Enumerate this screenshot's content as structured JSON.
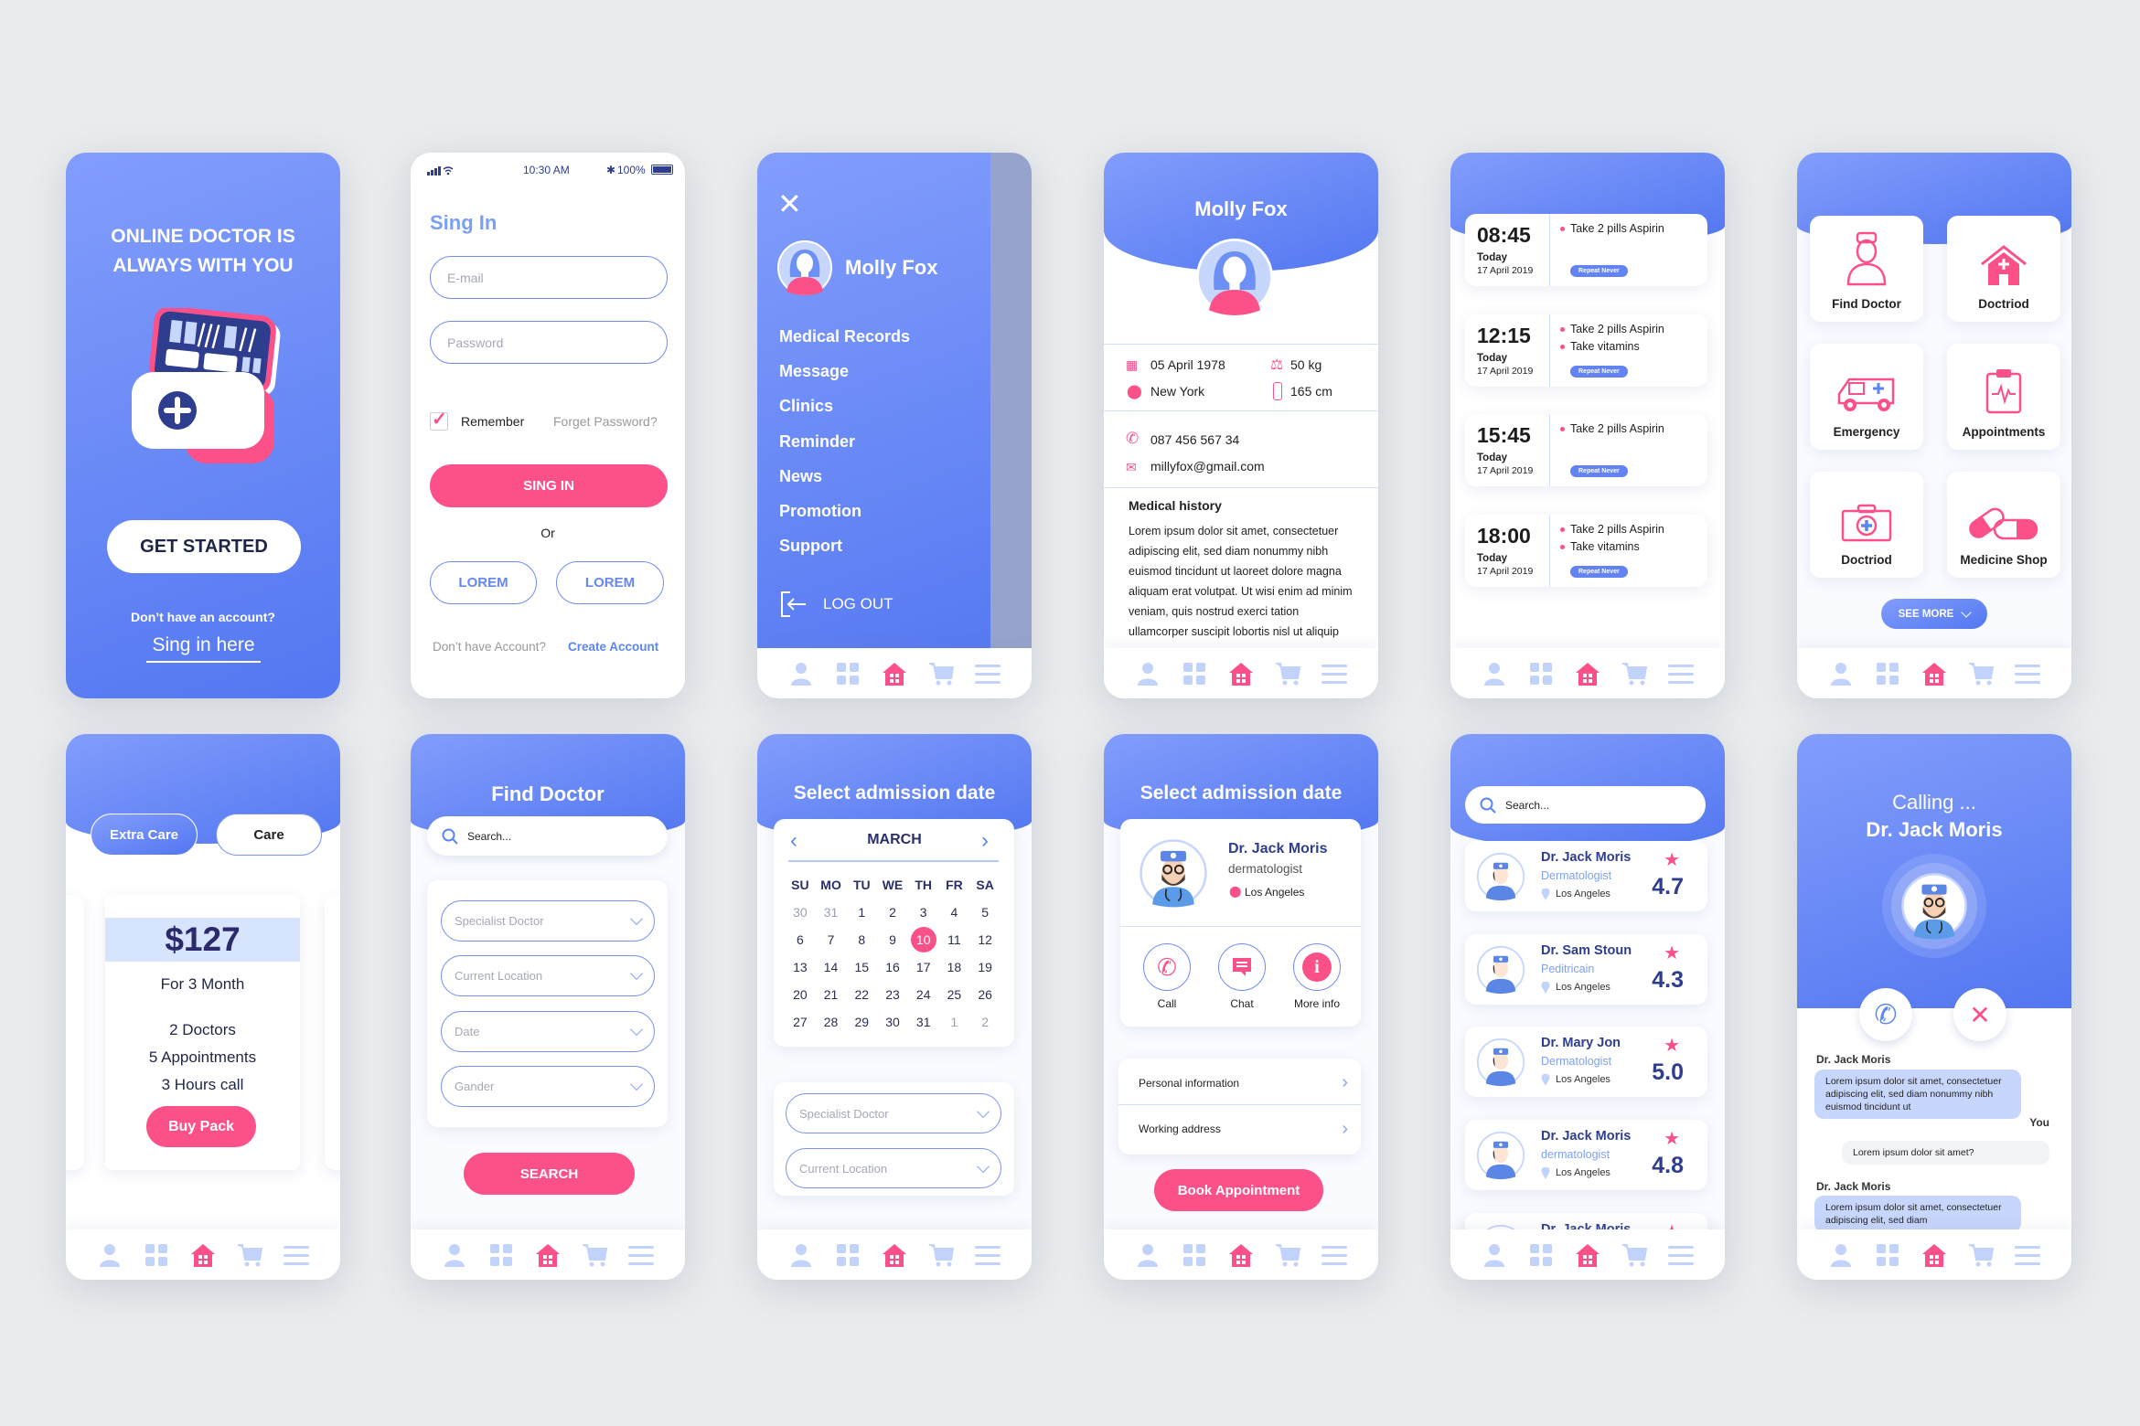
{
  "colors": {
    "primary": "#5b7df2",
    "accent": "#fb5188",
    "navy": "#2e3d8e",
    "light": "#c7d6fc"
  },
  "bottom_nav": [
    "person-icon",
    "grid-icon",
    "home-icon",
    "cart-icon",
    "menu-icon"
  ],
  "onboarding": {
    "title_line1": "ONLINE DOCTOR IS",
    "title_line2": "ALWAYS WITH YOU",
    "cta": "GET STARTED",
    "prompt": "Don’t have an account?",
    "link": "Sing in here"
  },
  "signin": {
    "status": {
      "time": "10:30 AM",
      "battery": "100%"
    },
    "title": "Sing In",
    "email_placeholder": "E-mail",
    "password_placeholder": "Password",
    "remember": "Remember",
    "remember_checked": true,
    "forgot": "Forget Password?",
    "submit": "SING IN",
    "or": "Or",
    "alt1": "LOREM",
    "alt2": "LOREM",
    "no_account": "Don’t have Account?",
    "create": "Create Account"
  },
  "menu": {
    "user": "Molly Fox",
    "items": [
      "Medical Records",
      "Message",
      "Clinics",
      "Reminder",
      "News",
      "Promotion",
      "Support"
    ],
    "logout": "LOG OUT"
  },
  "profile": {
    "name": "Molly Fox",
    "dob": "05 April 1978",
    "city": "New York",
    "weight": "50 kg",
    "height": "165 cm",
    "phone": "087 456 567 34",
    "email": "millyfox@gmail.com",
    "history_title": "Medical history",
    "history": "Lorem ipsum dolor sit amet, consectetuer adipiscing elit, sed diam nonummy nibh euismod tincidunt ut laoreet dolore magna aliquam erat volutpat. Ut wisi enim ad minim veniam, quis nostrud exerci tation ullamcorper suscipit lobortis nisl ut aliquip"
  },
  "reminders": [
    {
      "time": "08:45",
      "day": "Today",
      "date": "17 April 2019",
      "meds": [
        "Take 2 pills Aspirin"
      ],
      "badge": "Repeat Never"
    },
    {
      "time": "12:15",
      "day": "Today",
      "date": "17 April 2019",
      "meds": [
        "Take 2 pills Aspirin",
        "Take vitamins"
      ],
      "badge": "Repeat Never"
    },
    {
      "time": "15:45",
      "day": "Today",
      "date": "17 April 2019",
      "meds": [
        "Take 2 pills Aspirin"
      ],
      "badge": "Repeat Never"
    },
    {
      "time": "18:00",
      "day": "Today",
      "date": "17 April 2019",
      "meds": [
        "Take 2 pills Aspirin",
        "Take vitamins"
      ],
      "badge": "Repeat Never"
    }
  ],
  "home_grid": {
    "tiles": [
      "Find Doctor",
      "Doctriod",
      "Emergency",
      "Appointments",
      "Doctriod",
      "Medicine Shop"
    ],
    "see_more": "SEE MORE"
  },
  "plans": {
    "tabs": [
      "Extra Care",
      "Care"
    ],
    "active_tab": "Extra Care",
    "price": "$127",
    "period": "For 3 Month",
    "features": [
      "2 Doctors",
      "5 Appointments",
      "3 Hours call"
    ],
    "buy": "Buy Pack"
  },
  "find_doctor": {
    "title": "Find Doctor",
    "search_placeholder": "Search...",
    "selects": [
      "Specialist Doctor",
      "Current Location",
      "Date",
      "Gander"
    ],
    "submit": "SEARCH"
  },
  "calendar": {
    "title": "Select admission date",
    "month": "MARCH",
    "weekdays": [
      "SU",
      "MO",
      "TU",
      "WE",
      "TH",
      "FR",
      "SA"
    ],
    "weeks": [
      [
        "30",
        "31",
        "1",
        "2",
        "3",
        "4",
        "5"
      ],
      [
        "6",
        "7",
        "8",
        "9",
        "10",
        "11",
        "12"
      ],
      [
        "13",
        "14",
        "15",
        "16",
        "17",
        "18",
        "19"
      ],
      [
        "20",
        "21",
        "22",
        "23",
        "24",
        "25",
        "26"
      ],
      [
        "27",
        "28",
        "29",
        "30",
        "31",
        "1",
        "2"
      ]
    ],
    "selected": "10",
    "selects": [
      "Specialist Doctor",
      "Current Location"
    ]
  },
  "doctor_detail": {
    "title": "Select admission date",
    "name": "Dr. Jack Moris",
    "specialty": "dermatologist",
    "location": "Los Angeles",
    "actions": [
      "Call",
      "Chat",
      "More info"
    ],
    "rows": [
      "Personal information",
      "Working address"
    ],
    "book": "Book Appointment"
  },
  "doctor_list": {
    "search_placeholder": "Search...",
    "doctors": [
      {
        "name": "Dr. Jack Moris",
        "specialty": "Dermatologist",
        "location": "Los Angeles",
        "rating": "4.7"
      },
      {
        "name": "Dr. Sam Stoun",
        "specialty": "Peditricain",
        "location": "Los Angeles",
        "rating": "4.3"
      },
      {
        "name": "Dr. Mary Jon",
        "specialty": "Dermatologist",
        "location": "Los Angeles",
        "rating": "5.0"
      },
      {
        "name": "Dr. Jack Moris",
        "specialty": "dermatologist",
        "location": "Los Angeles",
        "rating": "4.8"
      },
      {
        "name": "Dr. Jack Moris"
      }
    ]
  },
  "calling": {
    "status": "Calling ...",
    "name": "Dr. Jack Moris",
    "messages": [
      {
        "sender": "Dr. Jack Moris",
        "text": "Lorem ipsum dolor sit amet, consectetuer adipiscing elit, sed diam nonummy nibh euismod tincidunt ut"
      },
      {
        "sender": "You",
        "text": "Lorem ipsum dolor sit amet?"
      },
      {
        "sender": "Dr. Jack Moris",
        "text": "Lorem ipsum dolor sit amet, consectetuer adipiscing elit, sed diam"
      }
    ]
  }
}
